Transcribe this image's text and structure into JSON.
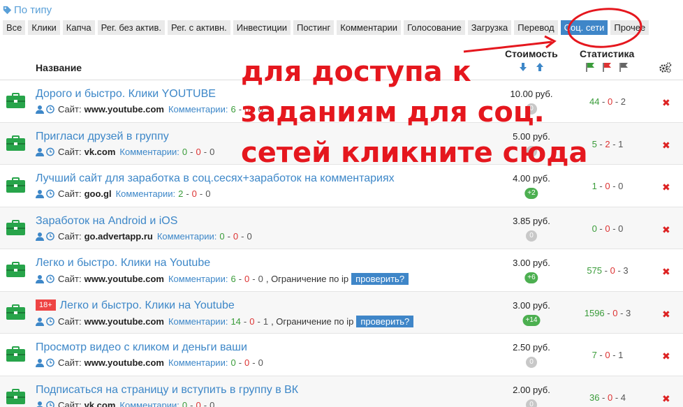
{
  "filter": {
    "label": "По типу"
  },
  "tabs": [
    {
      "label": "Все",
      "active": false
    },
    {
      "label": "Клики",
      "active": false
    },
    {
      "label": "Капча",
      "active": false
    },
    {
      "label": "Рег. без актив.",
      "active": false
    },
    {
      "label": "Рег. с активн.",
      "active": false
    },
    {
      "label": "Инвестиции",
      "active": false
    },
    {
      "label": "Постинг",
      "active": false
    },
    {
      "label": "Комментарии",
      "active": false
    },
    {
      "label": "Голосование",
      "active": false
    },
    {
      "label": "Загрузка",
      "active": false
    },
    {
      "label": "Перевод",
      "active": false
    },
    {
      "label": "Соц. сети",
      "active": true
    },
    {
      "label": "Прочее",
      "active": false
    }
  ],
  "table": {
    "col_name": "Название",
    "col_cost": "Стоимость",
    "col_stats": "Статистика"
  },
  "labels": {
    "site": "Сайт:",
    "comments": "Комментарии:",
    "limit": ", Ограничение по ip",
    "check": "проверить?"
  },
  "rows": [
    {
      "title": "Дорого и быстро. Клики YOUTUBE",
      "adult": "",
      "site": "www.youtube.com",
      "c1": "6",
      "c2": "0",
      "c3": "0",
      "limit": false,
      "price": "10.00 руб.",
      "badge": "0",
      "s1": "44",
      "s2": "0",
      "s3": "2"
    },
    {
      "title": "Пригласи друзей в группу",
      "adult": "",
      "site": "vk.com",
      "c1": "0",
      "c2": "0",
      "c3": "0",
      "limit": false,
      "price": "5.00 руб.",
      "badge": "0",
      "s1": "5",
      "s2": "2",
      "s3": "1"
    },
    {
      "title": "Лучший сайт для заработка в соц.сесях+заработок на комментариях",
      "adult": "",
      "site": "goo.gl",
      "c1": "2",
      "c2": "0",
      "c3": "0",
      "limit": false,
      "price": "4.00 руб.",
      "badge": "+2",
      "s1": "1",
      "s2": "0",
      "s3": "0"
    },
    {
      "title": "Заработок на Android и iOS",
      "adult": "",
      "site": "go.advertapp.ru",
      "c1": "0",
      "c2": "0",
      "c3": "0",
      "limit": false,
      "price": "3.85 руб.",
      "badge": "0",
      "s1": "0",
      "s2": "0",
      "s3": "0"
    },
    {
      "title": "Легко и быстро. Клики на Youtube",
      "adult": "",
      "site": "www.youtube.com",
      "c1": "6",
      "c2": "0",
      "c3": "0",
      "limit": true,
      "price": "3.00 руб.",
      "badge": "+6",
      "s1": "575",
      "s2": "0",
      "s3": "3"
    },
    {
      "title": "Легко и быстро. Клики на Youtube",
      "adult": "18+",
      "site": "www.youtube.com",
      "c1": "14",
      "c2": "0",
      "c3": "1",
      "limit": true,
      "price": "3.00 руб.",
      "badge": "+14",
      "s1": "1596",
      "s2": "0",
      "s3": "3"
    },
    {
      "title": "Просмотр видео с кликом и деньги ваши",
      "adult": "",
      "site": "www.youtube.com",
      "c1": "0",
      "c2": "0",
      "c3": "0",
      "limit": false,
      "price": "2.50 руб.",
      "badge": "0",
      "s1": "7",
      "s2": "0",
      "s3": "1"
    },
    {
      "title": "Подписаться на страницу и вступить в группу в ВК",
      "adult": "",
      "site": "vk.com",
      "c1": "0",
      "c2": "0",
      "c3": "0",
      "limit": false,
      "price": "2.00 руб.",
      "badge": "0",
      "s1": "36",
      "s2": "0",
      "s3": "4"
    }
  ],
  "annotation": {
    "line1": "для доступа к",
    "line2": "заданиям для соц.",
    "line3": "сетей кликните сюда"
  },
  "colors": {
    "accent": "#3f86c8",
    "green": "#3a9c3a",
    "red": "#d33",
    "annotation": "#e5171e"
  }
}
